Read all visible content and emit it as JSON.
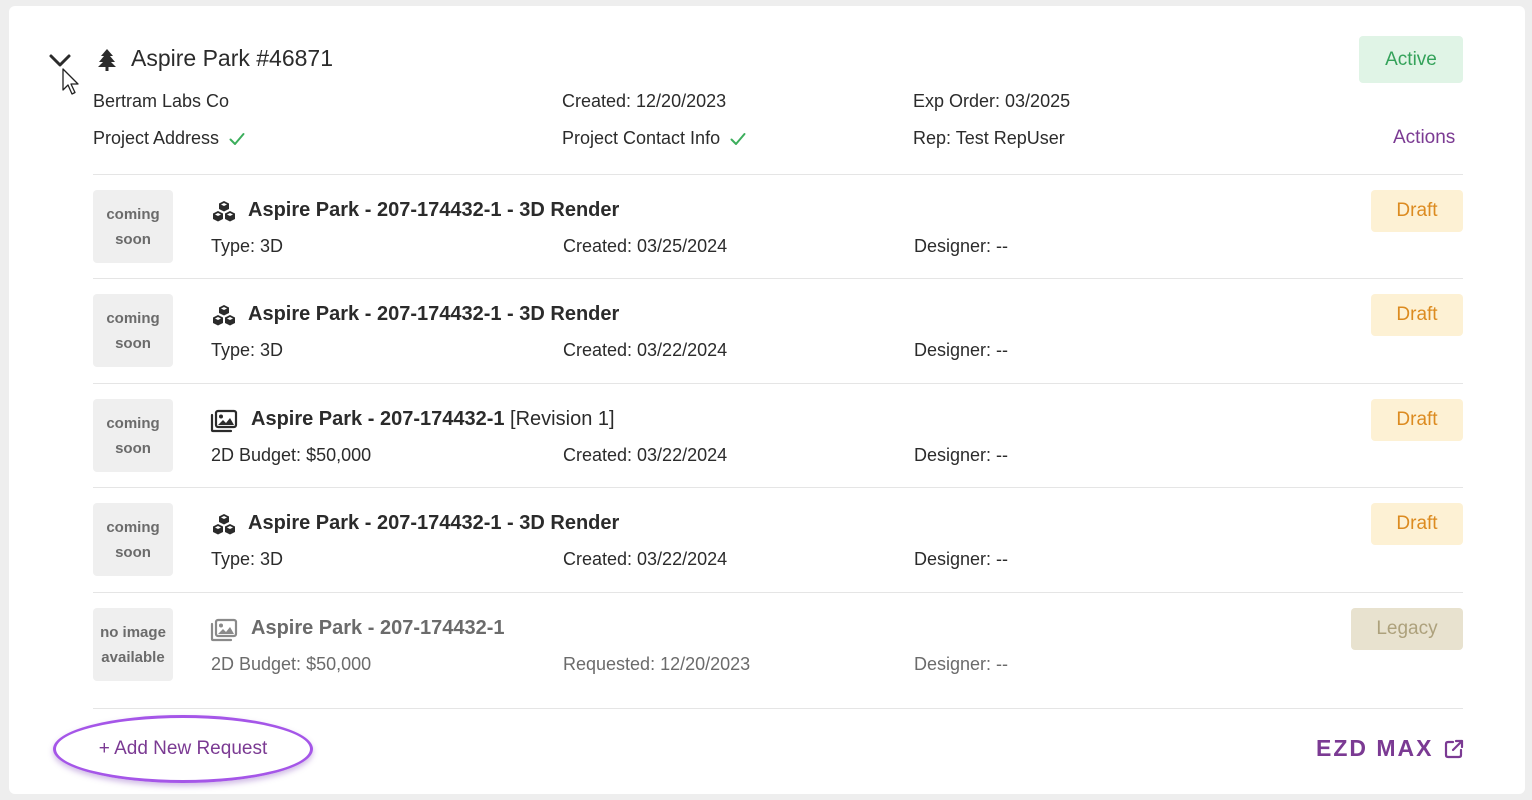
{
  "project": {
    "title": "Aspire Park #46871",
    "icon": "tree-icon",
    "status": "Active",
    "company": "Bertram Labs Co",
    "created": "Created: 12/20/2023",
    "exp_order": "Exp Order: 03/2025",
    "address_label": "Project Address",
    "contact_label": "Project Contact Info",
    "rep": "Rep: Test RepUser",
    "actions_label": "Actions"
  },
  "requests": [
    {
      "thumb": [
        "coming",
        "soon"
      ],
      "icon": "cubes-icon",
      "title": "Aspire Park - 207-174432-1 - 3D Render",
      "title_suffix": "",
      "type": "Type: 3D",
      "created": "Created: 03/25/2024",
      "designer": "Designer: --",
      "status": "Draft"
    },
    {
      "thumb": [
        "coming",
        "soon"
      ],
      "icon": "cubes-icon",
      "title": "Aspire Park - 207-174432-1 - 3D Render",
      "title_suffix": "",
      "type": "Type: 3D",
      "created": "Created: 03/22/2024",
      "designer": "Designer: --",
      "status": "Draft"
    },
    {
      "thumb": [
        "coming",
        "soon"
      ],
      "icon": "images-icon",
      "title": "Aspire Park - 207-174432-1",
      "title_suffix": " [Revision 1]",
      "type": "2D Budget: $50,000",
      "created": "Created: 03/22/2024",
      "designer": "Designer: --",
      "status": "Draft"
    },
    {
      "thumb": [
        "coming",
        "soon"
      ],
      "icon": "cubes-icon",
      "title": "Aspire Park - 207-174432-1 - 3D Render",
      "title_suffix": "",
      "type": "Type: 3D",
      "created": "Created: 03/22/2024",
      "designer": "Designer: --",
      "status": "Draft"
    },
    {
      "thumb": [
        "no image",
        "available"
      ],
      "icon": "images-icon",
      "title": "Aspire Park - 207-174432-1",
      "title_suffix": "",
      "type": "2D Budget: $50,000",
      "created": "Requested: 12/20/2023",
      "designer": "Designer: --",
      "status": "Legacy"
    }
  ],
  "footer": {
    "add_request_label": "+ Add New Request",
    "logo_text": "EZD MAX",
    "logo_icon": "external-link-icon"
  },
  "colors": {
    "accent": "#7b3a93",
    "active_bg": "#e0f4e6",
    "active_text": "#34a25a",
    "draft_bg": "#fdf1d4",
    "draft_text": "#dc8b20",
    "legacy_bg": "#e8e2cf",
    "legacy_text": "#ada17c",
    "check": "#3cae5c"
  }
}
